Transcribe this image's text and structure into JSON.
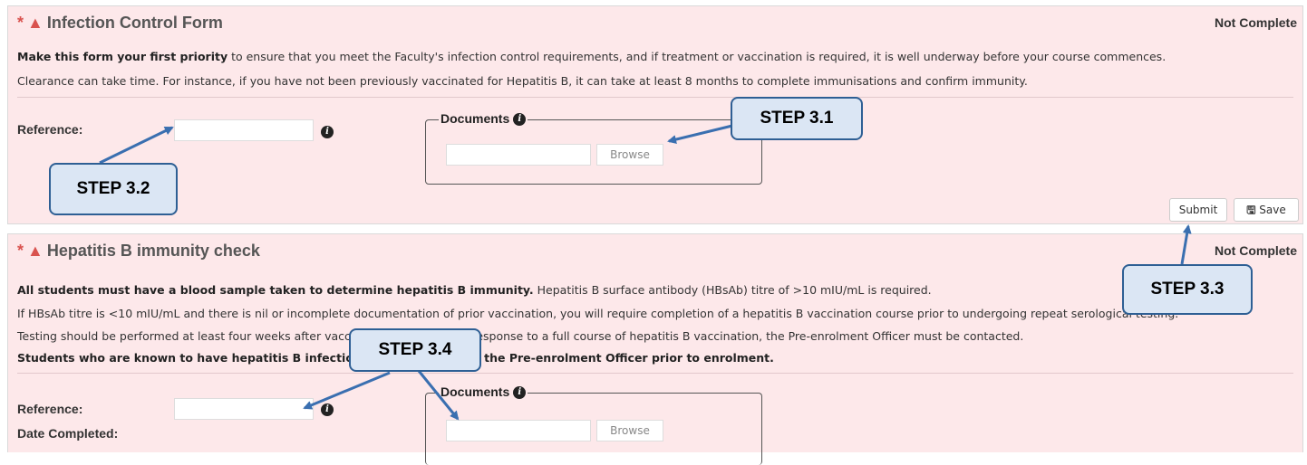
{
  "form1": {
    "title": "Infection Control Form",
    "status": "Not Complete",
    "intro_bold": "Make this form your first priority",
    "intro_rest": " to ensure that you meet the Faculty's infection control requirements, and if treatment or vaccination is required, it is well underway before your course commences.",
    "line2": "Clearance can take time. For instance, if you have not been previously vaccinated for Hepatitis B, it can take at least 8 months to complete immunisations and confirm immunity.",
    "reference_label": "Reference:",
    "documents_label": "Documents",
    "browse_label": "Browse",
    "submit_label": "Submit",
    "save_label": "Save"
  },
  "form2": {
    "title": "Hepatitis B immunity check",
    "status": "Not Complete",
    "line1_bold": "All students must have a blood sample taken to determine hepatitis B immunity.",
    "line1_rest": " Hepatitis B surface antibody (HBsAb) titre of >10 mIU/mL is required.",
    "line2": "If HBsAb titre is <10 mIU/mL and there is nil or incomplete documentation of prior vaccination, you will require completion of a hepatitis B vaccination course prior to undergoing repeat serological testing.",
    "line3": "Testing should be performed at least four weeks after vaccination. If there is no response to a full course of hepatitis B vaccination, the Pre-enrolment Officer must be contacted.",
    "line4": "Students who are known to have hepatitis B infection must discuss with the Pre-enrolment Officer prior to enrolment.",
    "reference_label": "Reference:",
    "date_label": "Date Completed:",
    "documents_label": "Documents",
    "browse_label": "Browse"
  },
  "callouts": {
    "step_3_1": "STEP 3.1",
    "step_3_2": "STEP 3.2",
    "step_3_3": "STEP 3.3",
    "step_3_4": "STEP 3.4"
  },
  "icons": {
    "required": "asterisk-icon",
    "warning": "warning-triangle-icon",
    "info": "info-icon",
    "save": "floppy-disk-icon"
  },
  "colors": {
    "panel_bg": "#fde8ea",
    "required_red": "#d9534f",
    "callout_fill": "#dbe6f4",
    "callout_border": "#2e5f94",
    "arrow": "#3a6fb0"
  }
}
